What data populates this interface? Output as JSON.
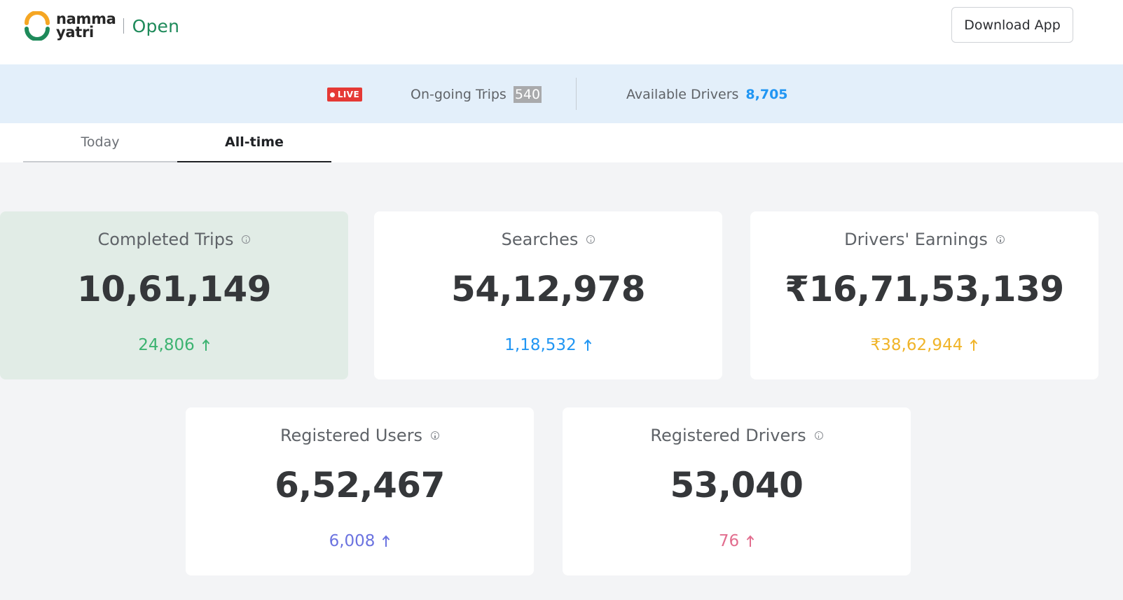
{
  "header": {
    "logo_line1": "namma",
    "logo_line2": "yatri",
    "logo_open": "Open",
    "download_label": "Download App"
  },
  "live": {
    "badge": "LIVE",
    "ongoing_label": "On-going Trips",
    "ongoing_value": "540",
    "available_label": "Available Drivers",
    "available_value": "8,705"
  },
  "tabs": [
    {
      "label": "Today",
      "active": false
    },
    {
      "label": "All-time",
      "active": true
    }
  ],
  "cards": [
    {
      "title": "Completed Trips",
      "value": "10,61,149",
      "delta": "24,806",
      "color": "#3cb371"
    },
    {
      "title": "Searches",
      "value": "54,12,978",
      "delta": "1,18,532",
      "color": "#2196f3"
    },
    {
      "title": "Drivers' Earnings",
      "value": "₹16,71,53,139",
      "delta": "₹38,62,944",
      "color": "#f0b429"
    },
    {
      "title": "Registered Users",
      "value": "6,52,467",
      "delta": "6,008",
      "color": "#6b73e0"
    },
    {
      "title": "Registered Drivers",
      "value": "53,040",
      "delta": "76",
      "color": "#e26d8e"
    }
  ],
  "icons": {
    "logo": "namma-yatri-logo-icon",
    "info": "info-icon",
    "arrow": "arrow-up-icon",
    "live_dot": "live-dot-icon"
  }
}
